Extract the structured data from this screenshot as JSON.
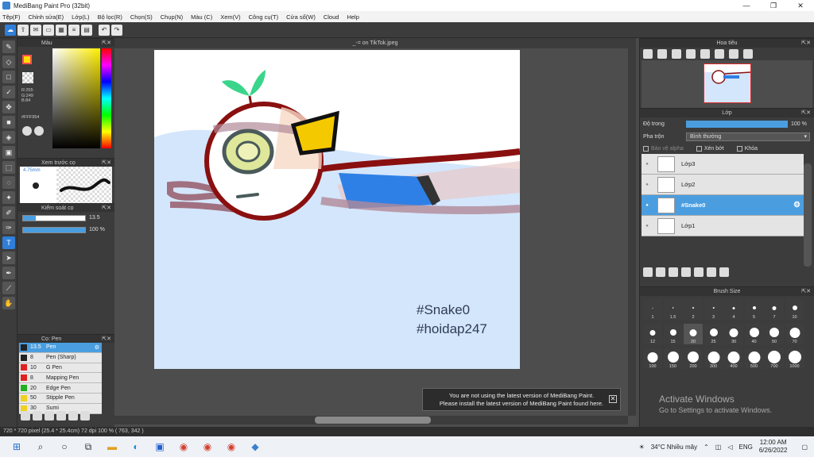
{
  "window": {
    "title": "MediBang Paint Pro (32bit)",
    "min": "—",
    "max": "❐",
    "close": "✕"
  },
  "menu": [
    "Tệp(F)",
    "Chỉnh sửa(E)",
    "Lớp(L)",
    "Bộ lọc(R)",
    "Chọn(S)",
    "Chụp(N)",
    "Màu (C)",
    "Xem(V)",
    "Công cụ(T)",
    "Cửa sổ(W)",
    "Cloud",
    "Help"
  ],
  "toolbar": {
    "undo": "↶",
    "redo": "↷"
  },
  "color_panel": {
    "title": "Màu",
    "r": "R:255",
    "g": "G:249",
    "b": "B:84",
    "hex": "#FFF954",
    "fg_color": "#ffdd00"
  },
  "brush_preview": {
    "title": "Xem trước cọ",
    "size": "4.75mm"
  },
  "brush_control": {
    "title": "Kiểm soát cọ",
    "size_value": "13.5",
    "opacity_value": "100 %",
    "size_fraction": 0.2,
    "opacity_fraction": 1.0
  },
  "brush_list": {
    "title": "Cọ: Pen",
    "items": [
      {
        "size": "13.5",
        "name": "Pen",
        "color": "#222222",
        "selected": true
      },
      {
        "size": "8",
        "name": "Pen (Sharp)",
        "color": "#222222",
        "selected": false
      },
      {
        "size": "10",
        "name": "G Pen",
        "color": "#e02020",
        "selected": false
      },
      {
        "size": "8",
        "name": "Mapping Pen",
        "color": "#e02020",
        "selected": false
      },
      {
        "size": "20",
        "name": "Edge Pen",
        "color": "#20b020",
        "selected": false
      },
      {
        "size": "50",
        "name": "Stipple Pen",
        "color": "#f0d020",
        "selected": false
      },
      {
        "size": "30",
        "name": "Sumi",
        "color": "#f0d020",
        "selected": false
      }
    ]
  },
  "document": {
    "tab": "_-= on TikTok.jpeg",
    "text1": "#Snake0",
    "text2": "#hoidap247"
  },
  "notification": {
    "line1": "You are not using the latest version of MediBang Paint.",
    "line2": "Please install the latest version of MediBang Paint found here.",
    "close": "✕"
  },
  "navigator": {
    "title": "Hoa tiêu"
  },
  "layer_panel": {
    "title": "Lớp",
    "opacity_label": "Độ trong",
    "opacity_value": "100 %",
    "blend_label": "Pha trộn",
    "blend_value": "Bình thường",
    "protect_alpha": "Bảo vệ alpha",
    "clipping": "Xén bớt",
    "lock": "Khóa",
    "layers": [
      {
        "name": "Lớp3",
        "selected": false
      },
      {
        "name": "Lớp2",
        "selected": false
      },
      {
        "name": "#Snake0",
        "selected": true
      },
      {
        "name": "Lớp1",
        "selected": false
      }
    ]
  },
  "brush_size": {
    "title": "Brush Size",
    "sizes": [
      "1",
      "1.5",
      "2",
      "3",
      "4",
      "5",
      "7",
      "10",
      "12",
      "15",
      "20",
      "25",
      "30",
      "40",
      "50",
      "70",
      "100",
      "150",
      "200",
      "300",
      "400",
      "500",
      "700",
      "1000"
    ]
  },
  "watermark": {
    "line1": "Activate Windows",
    "line2": "Go to Settings to activate Windows."
  },
  "status": "720 * 720 pixel  (25.4 * 25.4cm)  72 dpi  100 %  ( 763, 342 )",
  "taskbar": {
    "weather": "34°C  Nhiều mây",
    "lang": "ENG",
    "time": "12:00 AM",
    "date": "6/26/2022"
  }
}
